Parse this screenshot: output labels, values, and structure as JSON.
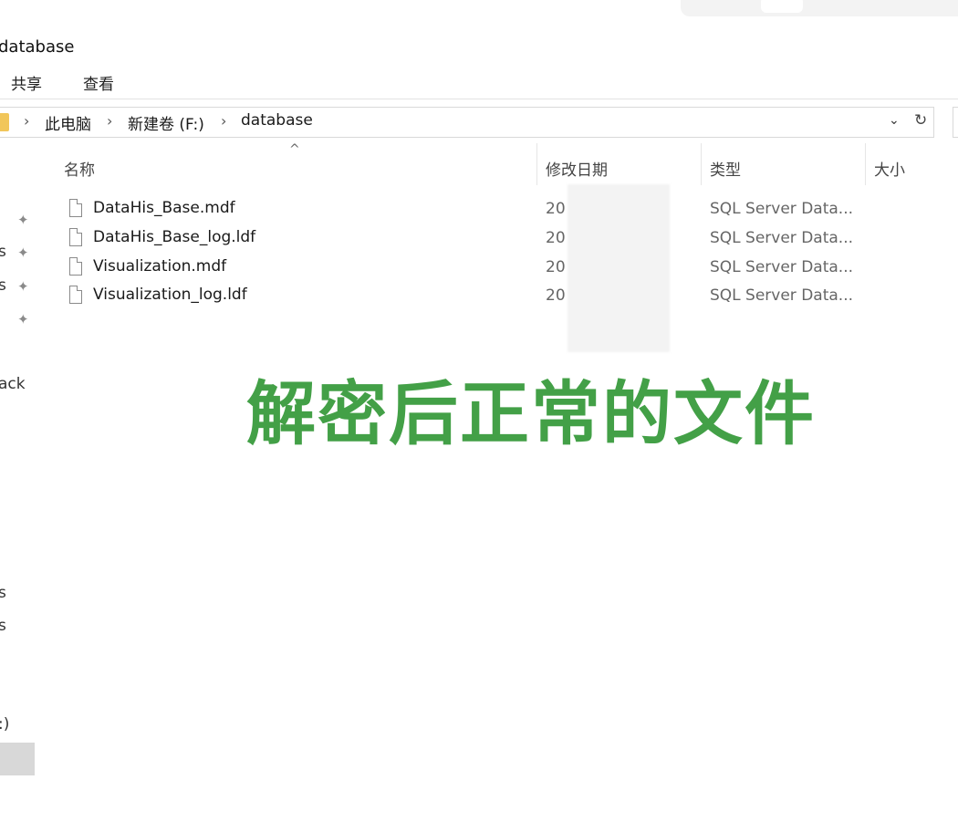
{
  "window": {
    "title": "database"
  },
  "ribbon": {
    "tabs": [
      "共享",
      "查看"
    ]
  },
  "address_bar": {
    "crumbs": [
      "此电脑",
      "新建卷 (F:)",
      "database"
    ]
  },
  "columns": {
    "name": "名称",
    "date_modified": "修改日期",
    "type": "类型",
    "size": "大小"
  },
  "files": [
    {
      "name": "DataHis_Base.mdf",
      "date": "20",
      "type": "SQL Server Data..."
    },
    {
      "name": "DataHis_Base_log.ldf",
      "date": "20",
      "type": "SQL Server Data..."
    },
    {
      "name": "Visualization.mdf",
      "date": "20",
      "type": "SQL Server Data..."
    },
    {
      "name": "Visualization_log.ldf",
      "date": "20",
      "type": "SQL Server Data..."
    }
  ],
  "nav_fragments": [
    "s",
    "s",
    "ack",
    "s",
    "s",
    ":)"
  ],
  "overlay_caption": "解密后正常的文件",
  "colors": {
    "caption_green": "#43a047",
    "folder_yellow": "#f1c65a"
  },
  "icons": {
    "pin": "pin-icon",
    "file": "file-icon",
    "folder": "folder-icon",
    "refresh": "refresh-icon",
    "chevron": "chevron-right-icon",
    "dropdown": "chevron-down-icon",
    "sort": "sort-up-icon"
  }
}
